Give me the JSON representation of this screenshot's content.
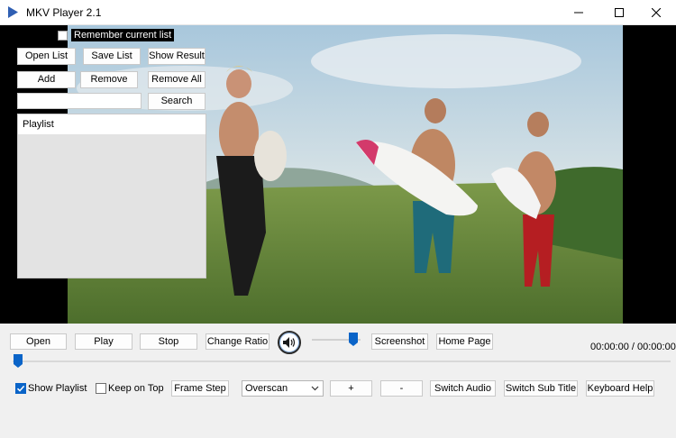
{
  "window": {
    "title": "MKV Player 2.1",
    "accent_color": "#0a64c8"
  },
  "overlay": {
    "remember_label": "Remember current list",
    "remember_checked": false,
    "open_list": "Open List",
    "save_list": "Save List",
    "show_result": "Show Result",
    "add": "Add",
    "remove": "Remove",
    "remove_all": "Remove All",
    "search_value": "",
    "search": "Search",
    "playlist_header": "Playlist"
  },
  "controls": {
    "open": "Open",
    "play": "Play",
    "stop": "Stop",
    "change_ratio": "Change Ratio",
    "screenshot": "Screenshot",
    "home_page": "Home Page",
    "volume_level": 0.82,
    "time": "00:00:00 / 00:00:00",
    "seek_position": 0.0,
    "show_playlist_label": "Show Playlist",
    "show_playlist_checked": true,
    "keep_on_top_label": "Keep on Top",
    "keep_on_top_checked": false,
    "frame_step": "Frame Step",
    "scale_mode": "Overscan",
    "plus": "+",
    "minus": "-",
    "switch_audio": "Switch Audio",
    "switch_sub_title": "Switch Sub Title",
    "keyboard_help": "Keyboard Help"
  },
  "icons": {
    "app": "play-triangle-icon",
    "minimize": "minimize-icon",
    "maximize": "maximize-icon",
    "close": "close-icon",
    "volume": "speaker-icon",
    "dropdown": "chevron-down-icon"
  }
}
